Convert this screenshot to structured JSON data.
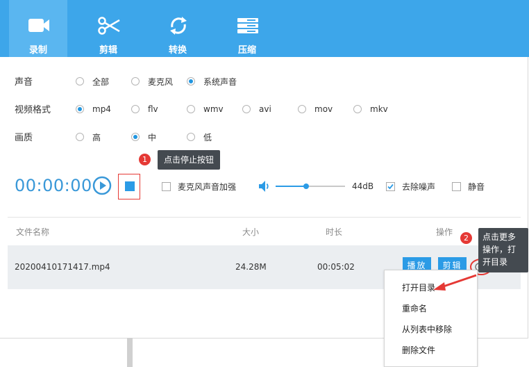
{
  "tabs": [
    {
      "label": "录制",
      "icon": "video-camera-icon",
      "active": true
    },
    {
      "label": "剪辑",
      "icon": "scissors-icon",
      "active": false
    },
    {
      "label": "转换",
      "icon": "convert-arrows-icon",
      "active": false
    },
    {
      "label": "压缩",
      "icon": "compress-icon",
      "active": false
    }
  ],
  "settings": {
    "sound": {
      "label": "声音",
      "options": [
        "全部",
        "麦克风",
        "系统声音"
      ],
      "selected": "系统声音"
    },
    "format": {
      "label": "视频格式",
      "options": [
        "mp4",
        "flv",
        "wmv",
        "avi",
        "mov",
        "mkv"
      ],
      "selected": "mp4"
    },
    "quality": {
      "label": "画质",
      "options": [
        "高",
        "中",
        "低"
      ],
      "selected": "中"
    }
  },
  "tips": {
    "stop": {
      "number": "1",
      "text": "点击停止按钮"
    },
    "more": {
      "number": "2",
      "text_lines": [
        "点击更多",
        "操作，打",
        "开目录"
      ]
    }
  },
  "controls": {
    "timer": "00:00:00",
    "mic_boost_label": "麦克风声音加强",
    "mic_boost_checked": false,
    "volume_value": "44dB",
    "volume_level": 0.44,
    "denoise_label": "去除噪声",
    "denoise_checked": true,
    "mute_label": "静音",
    "mute_checked": false
  },
  "table": {
    "headers": {
      "name": "文件名称",
      "size": "大小",
      "duration": "时长",
      "actions": "操作"
    },
    "rows": [
      {
        "name": "20200410171417.mp4",
        "size": "24.28M",
        "duration": "00:05:02",
        "play": "播放",
        "edit": "剪辑"
      }
    ]
  },
  "context_menu": [
    "打开目录",
    "重命名",
    "从列表中移除",
    "删除文件"
  ],
  "colors": {
    "accent": "#3da6ea",
    "button": "#2b9be6",
    "highlight": "#e53935"
  }
}
